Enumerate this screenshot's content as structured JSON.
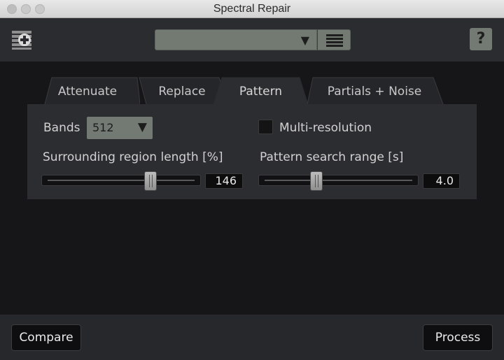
{
  "window": {
    "title": "Spectral Repair"
  },
  "toolbar": {
    "preset_value": "",
    "module_icon": "module-add-icon",
    "preset_menu_icon": "list-menu-icon",
    "help_label": "?"
  },
  "tabs": [
    {
      "label": "Attenuate",
      "active": false
    },
    {
      "label": "Replace",
      "active": false
    },
    {
      "label": "Pattern",
      "active": true
    },
    {
      "label": "Partials + Noise",
      "active": false
    }
  ],
  "pattern": {
    "bands_label": "Bands",
    "bands_value": "512",
    "multires_label": "Multi-resolution",
    "multires_checked": false,
    "surrounding_label": "Surrounding region length [%]",
    "surrounding_value": "146",
    "surrounding_fraction": 0.7,
    "search_label": "Pattern search range [s]",
    "search_value": "4.0",
    "search_fraction": 0.35
  },
  "footer": {
    "compare_label": "Compare",
    "process_label": "Process"
  },
  "colors": {
    "background": "#161618",
    "panel": "#2c2d30",
    "control_green": "#737a73"
  }
}
